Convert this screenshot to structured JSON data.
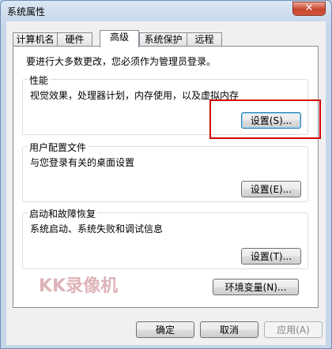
{
  "window": {
    "title": "系统属性",
    "close_symbol": "✕"
  },
  "tabs": [
    {
      "label": "计算机名"
    },
    {
      "label": "硬件"
    },
    {
      "label": "高级"
    },
    {
      "label": "系统保护"
    },
    {
      "label": "远程"
    }
  ],
  "admin_note": "要进行大多数更改，您必须作为管理员登录。",
  "performance": {
    "title": "性能",
    "desc": "视觉效果，处理器计划，内存使用，以及虚拟内存",
    "button": "设置(S)..."
  },
  "profiles": {
    "title": "用户配置文件",
    "desc": "与您登录有关的桌面设置",
    "button": "设置(E)..."
  },
  "startup": {
    "title": "启动和故障恢复",
    "desc": "系统启动、系统失败和调试信息",
    "button": "设置(T)..."
  },
  "env_button": "环境变量(N)...",
  "footer": {
    "ok": "确定",
    "cancel": "取消",
    "apply": "应用(A)"
  },
  "watermark": "KK录像机",
  "colors": {
    "highlight": "#d40000",
    "close": "#c7452c"
  }
}
